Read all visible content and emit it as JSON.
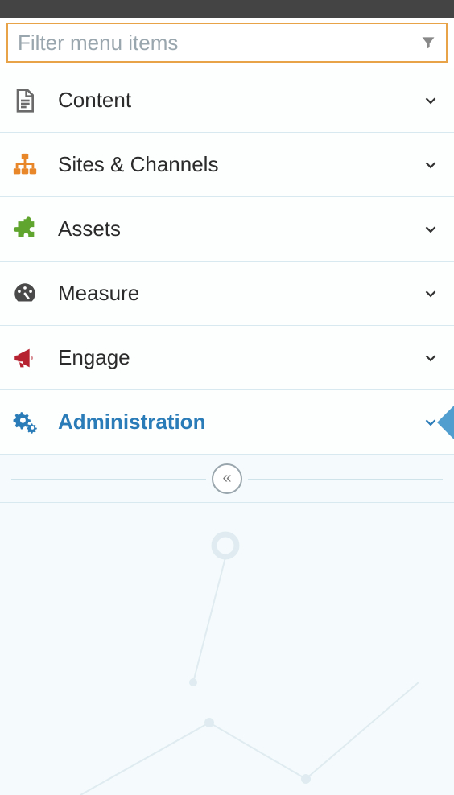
{
  "filter": {
    "placeholder": "Filter menu items"
  },
  "menu": {
    "items": [
      {
        "label": "Content",
        "icon": "document",
        "color": "#6a6a6a",
        "active": false
      },
      {
        "label": "Sites & Channels",
        "icon": "sitemap",
        "color": "#e8862a",
        "active": false
      },
      {
        "label": "Assets",
        "icon": "puzzle",
        "color": "#5fa52e",
        "active": false
      },
      {
        "label": "Measure",
        "icon": "gauge",
        "color": "#4a4a4a",
        "active": false
      },
      {
        "label": "Engage",
        "icon": "bullhorn",
        "color": "#b62230",
        "active": false
      },
      {
        "label": "Administration",
        "icon": "gears",
        "color": "#2a7cb8",
        "active": true
      }
    ]
  },
  "collapse": {
    "symbol": "«"
  }
}
